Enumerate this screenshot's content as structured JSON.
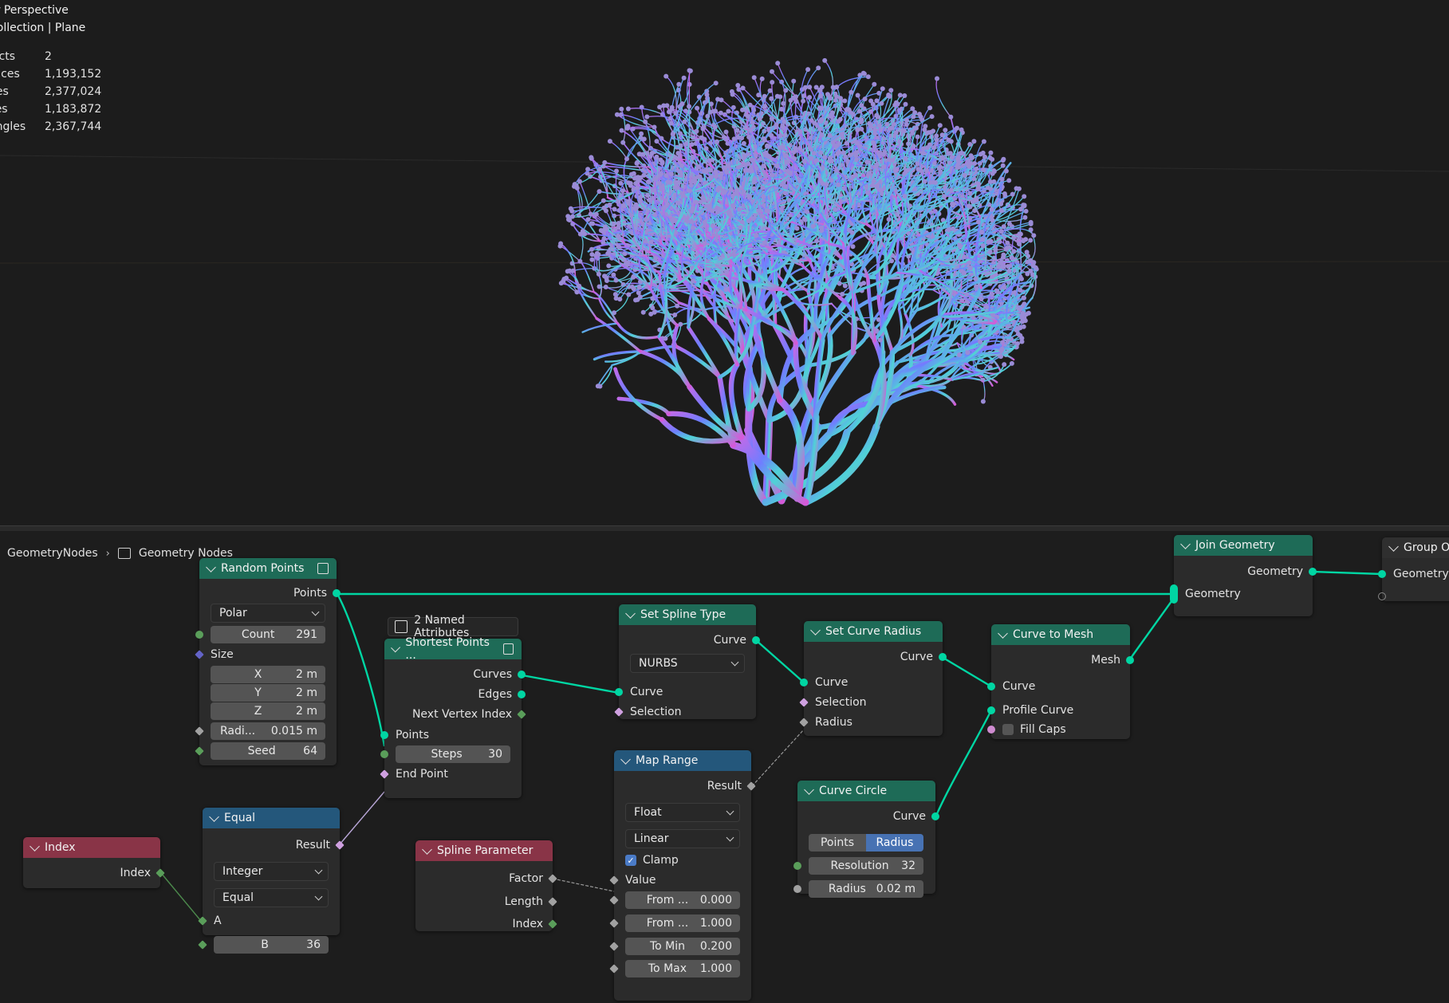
{
  "viewport": {
    "header_line1": "er Perspective",
    "header_line2": "Collection | Plane",
    "stats": [
      {
        "label": "jects",
        "value": "2"
      },
      {
        "label": "rtices",
        "value": "1,193,152"
      },
      {
        "label": "ges",
        "value": "2,377,024"
      },
      {
        "label": "ces",
        "value": "1,183,872"
      },
      {
        "label": "angles",
        "value": "2,367,744"
      }
    ]
  },
  "breadcrumb": {
    "item1": "GeometryNodes",
    "item2": "Geometry Nodes"
  },
  "colors": {
    "geometry_header": "#1e6b57",
    "vector_header": "#24577b",
    "input_header": "#893447",
    "link_geometry": "#00d6a3"
  },
  "nodes": {
    "random_points": {
      "title": "Random Points",
      "out_points": "Points",
      "mode": "Polar",
      "count_label": "Count",
      "count": "291",
      "size_label": "Size",
      "x_label": "X",
      "x": "2 m",
      "y_label": "Y",
      "y": "2 m",
      "z_label": "Z",
      "z": "2 m",
      "radius_label": "Radi...",
      "radius": "0.015 m",
      "seed_label": "Seed",
      "seed": "64"
    },
    "shortest_points": {
      "badge": "2 Named Attributes",
      "title": "Shortest Points ...",
      "out_curves": "Curves",
      "out_edges": "Edges",
      "out_next": "Next Vertex Index",
      "in_points": "Points",
      "steps_label": "Steps",
      "steps": "30",
      "in_end": "End Point"
    },
    "set_spline_type": {
      "title": "Set Spline Type",
      "out_curve": "Curve",
      "type": "NURBS",
      "in_curve": "Curve",
      "in_selection": "Selection"
    },
    "set_curve_radius": {
      "title": "Set Curve Radius",
      "out_curve": "Curve",
      "in_curve": "Curve",
      "in_selection": "Selection",
      "in_radius": "Radius"
    },
    "curve_to_mesh": {
      "title": "Curve to Mesh",
      "out_mesh": "Mesh",
      "in_curve": "Curve",
      "in_profile": "Profile Curve",
      "fill_caps": "Fill Caps"
    },
    "join_geometry": {
      "title": "Join Geometry",
      "out_geometry": "Geometry",
      "in_geometry": "Geometry"
    },
    "group_output": {
      "title": "Group O",
      "in_geometry": "Geometry"
    },
    "map_range": {
      "title": "Map Range",
      "out_result": "Result",
      "data_type": "Float",
      "interp": "Linear",
      "clamp": "Clamp",
      "in_value": "Value",
      "from_min_label": "From ...",
      "from_min": "0.000",
      "from_max_label": "From ...",
      "from_max": "1.000",
      "to_min_label": "To Min",
      "to_min": "0.200",
      "to_max_label": "To Max",
      "to_max": "1.000"
    },
    "curve_circle": {
      "title": "Curve Circle",
      "out_curve": "Curve",
      "mode_points": "Points",
      "mode_radius": "Radius",
      "res_label": "Resolution",
      "res": "32",
      "radius_label": "Radius",
      "radius": "0.02 m"
    },
    "equal": {
      "title": "Equal",
      "out_result": "Result",
      "data_type": "Integer",
      "op": "Equal",
      "in_a": "A",
      "b_label": "B",
      "b": "36"
    },
    "index": {
      "title": "Index",
      "out_index": "Index"
    },
    "spline_parameter": {
      "title": "Spline Parameter",
      "out_factor": "Factor",
      "out_length": "Length",
      "out_index": "Index"
    }
  }
}
